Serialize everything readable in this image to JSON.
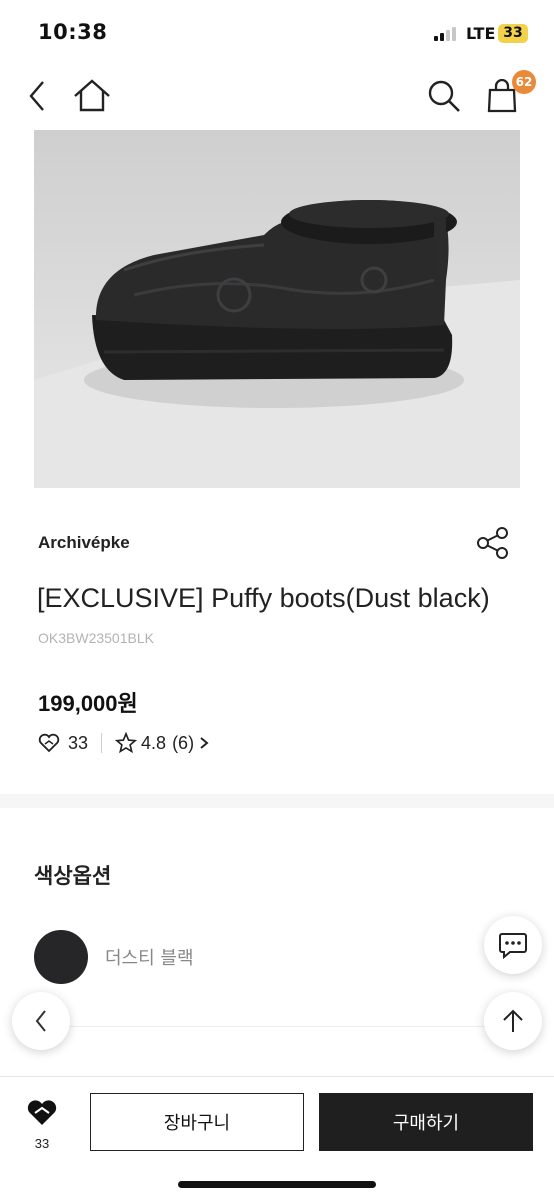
{
  "status_bar": {
    "time": "10:38",
    "network": "LTE",
    "battery": "33"
  },
  "nav": {
    "cart_count": "62"
  },
  "product": {
    "brand": "Archivépke",
    "title": "[EXCLUSIVE] Puffy boots(Dust black)",
    "code": "OK3BW23501BLK",
    "price": "199,000원",
    "likes": "33",
    "rating": "4.8",
    "review_count": "(6)"
  },
  "options": {
    "title": "색상옵션",
    "selected_color_label": "더스티 블랙",
    "selected_color_hex": "#262628"
  },
  "bottom_bar": {
    "like_count": "33",
    "cart_label": "장바구니",
    "buy_label": "구매하기"
  },
  "icons": [
    "back-icon",
    "home-icon",
    "search-icon",
    "shopping-bag-icon",
    "share-icon",
    "heart-icon",
    "star-icon",
    "chevron-right-icon",
    "chat-icon",
    "chevron-left-icon",
    "arrow-up-icon"
  ]
}
